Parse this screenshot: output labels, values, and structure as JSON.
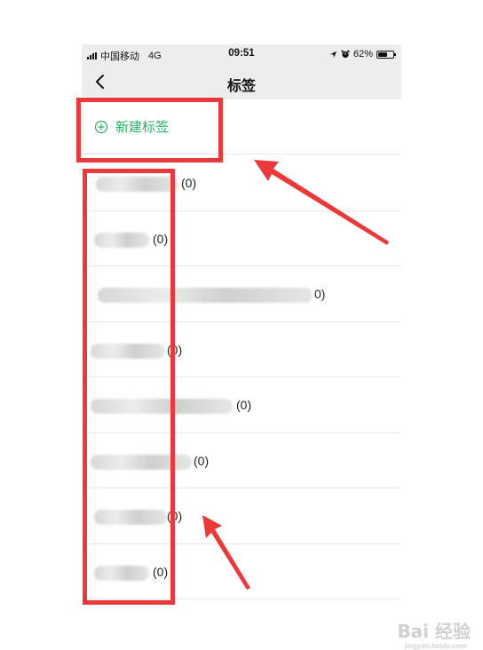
{
  "status_bar": {
    "carrier": "中国移动",
    "network": "4G",
    "time": "09:51",
    "battery_percent": "62%",
    "battery_level": 0.62
  },
  "nav": {
    "title": "标签",
    "back_icon": "chevron-left-icon"
  },
  "new_tag": {
    "label": "新建标签",
    "icon": "plus-circle-icon",
    "color": "#2aae67"
  },
  "tags": [
    {
      "count": "(0)"
    },
    {
      "count": "(0)"
    },
    {
      "count": "0)"
    },
    {
      "count": "(0)"
    },
    {
      "count": "(0)"
    },
    {
      "count": "(0)"
    },
    {
      "count": "(0)"
    },
    {
      "count": "(0)"
    }
  ],
  "annotation": {
    "highlight_color": "#e9393a"
  },
  "watermark": {
    "text": "Bai 经验",
    "subtext": "jingyan.baidu.com"
  }
}
